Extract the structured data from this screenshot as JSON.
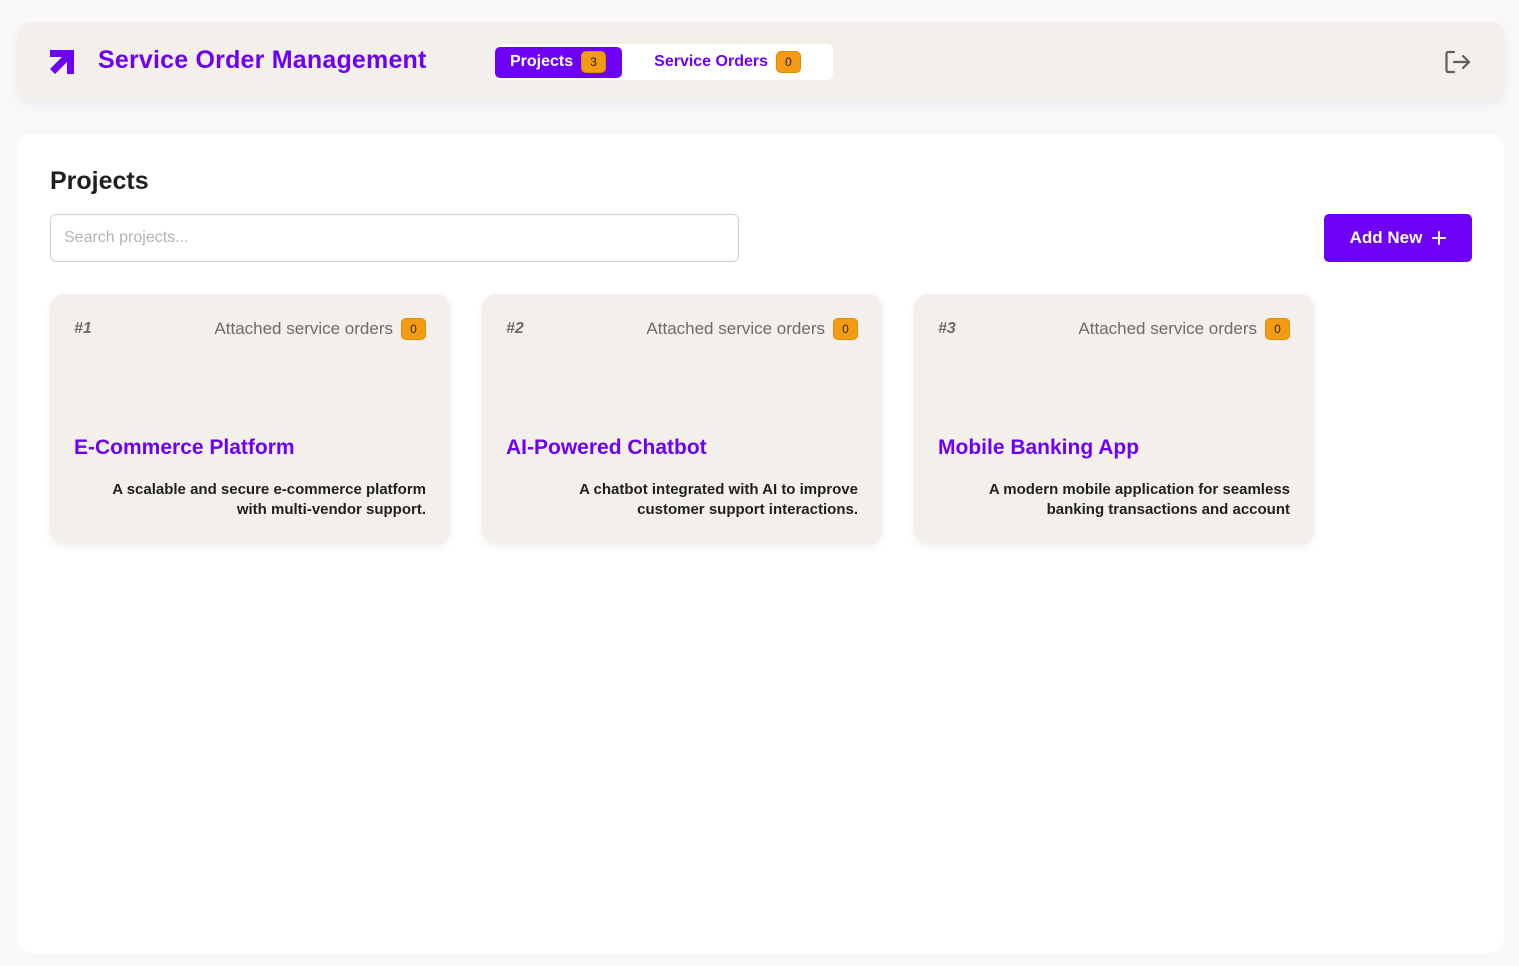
{
  "header": {
    "title": "Service Order Management",
    "tabs": [
      {
        "label": "Projects",
        "count": "3",
        "active": true
      },
      {
        "label": "Service Orders",
        "count": "0",
        "active": false
      }
    ]
  },
  "main": {
    "title": "Projects",
    "search_placeholder": "Search projects...",
    "add_button": "Add New"
  },
  "projects": [
    {
      "number": "#1",
      "attached_label": "Attached service orders",
      "attached_count": "0",
      "title": "E-Commerce Platform",
      "description": "A scalable and secure e-commerce platform with multi-vendor support."
    },
    {
      "number": "#2",
      "attached_label": "Attached service orders",
      "attached_count": "0",
      "title": "AI-Powered Chatbot",
      "description": "A chatbot integrated with AI to improve customer support interactions."
    },
    {
      "number": "#3",
      "attached_label": "Attached service orders",
      "attached_count": "0",
      "title": "Mobile Banking App",
      "description": "A modern mobile application for seamless banking transactions and account management."
    }
  ],
  "colors": {
    "accent": "#6d00f5",
    "badge": "#f59a14",
    "card_bg": "#f3f0eb"
  },
  "icons": {
    "logo": "arrow-up-right-icon",
    "logout": "logout-icon",
    "add": "plus-icon"
  }
}
